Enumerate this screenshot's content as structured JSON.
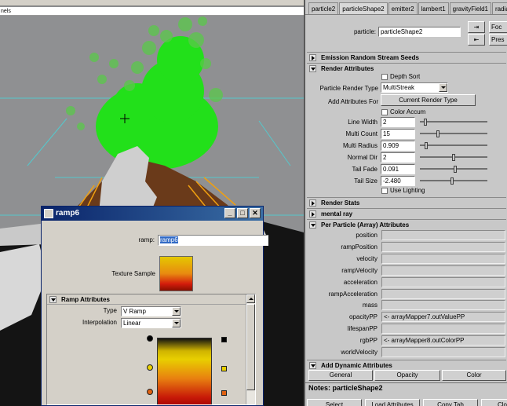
{
  "viewport": {
    "panels_label": "nels"
  },
  "ramp_window": {
    "title": "ramp6",
    "ramp_label": "ramp:",
    "ramp_value": "ramp6",
    "texture_sample_label": "Texture Sample",
    "section_title": "Ramp Attributes",
    "type_label": "Type",
    "type_value": "V Ramp",
    "interpolation_label": "Interpolation",
    "interpolation_value": "Linear",
    "colors": {
      "ramp_top": "#e8cf00",
      "ramp_mid": "#e88010",
      "ramp_bottom": "#c81a08"
    }
  },
  "attribute_editor": {
    "tabs": [
      "particle2",
      "particleShape2",
      "emitter2",
      "lambert1",
      "gravityField1",
      "radialField1"
    ],
    "active_tab": 1,
    "particle_label": "particle:",
    "particle_value": "particleShape2",
    "focus_button": "Foc",
    "presets_button": "Pres",
    "sections": {
      "emission": "Emission Random Stream Seeds",
      "render_attributes": "Render Attributes",
      "render_stats": "Render Stats",
      "mental_ray": "mental ray",
      "per_particle": "Per Particle (Array) Attributes",
      "add_dynamic": "Add Dynamic Attributes"
    },
    "render": {
      "depth_sort": "Depth Sort",
      "render_type_label": "Particle Render Type",
      "render_type_value": "MultiStreak",
      "add_attrs_label": "Add Attributes For",
      "current_render_type_button": "Current Render Type",
      "color_accum": "Color Accum",
      "use_lighting": "Use Lighting",
      "fields": [
        {
          "label": "Line Width",
          "value": "2",
          "slider": 0.06
        },
        {
          "label": "Multi Count",
          "value": "15",
          "slider": 0.25
        },
        {
          "label": "Multi Radius",
          "value": "0.909",
          "slider": 0.07
        },
        {
          "label": "Normal Dir",
          "value": "2",
          "slider": 0.5
        },
        {
          "label": "Tail Fade",
          "value": "0.091",
          "slider": 0.53
        },
        {
          "label": "Tail Size",
          "value": "-2.480",
          "slider": 0.48
        }
      ]
    },
    "per_particle_rows": [
      {
        "label": "position",
        "value": ""
      },
      {
        "label": "rampPosition",
        "value": ""
      },
      {
        "label": "velocity",
        "value": ""
      },
      {
        "label": "rampVelocity",
        "value": ""
      },
      {
        "label": "acceleration",
        "value": ""
      },
      {
        "label": "rampAcceleration",
        "value": ""
      },
      {
        "label": "mass",
        "value": ""
      },
      {
        "label": "opacityPP",
        "value": "<- arrayMapper7.outValuePP"
      },
      {
        "label": "lifespanPP",
        "value": ""
      },
      {
        "label": "rgbPP",
        "value": "<- arrayMapper8.outColorPP"
      },
      {
        "label": "worldVelocity",
        "value": ""
      }
    ],
    "dynamic_buttons": [
      "General",
      "Opacity",
      "Color"
    ],
    "notes_label": "Notes: particleShape2",
    "bottom_buttons": [
      "Select",
      "Load Attributes",
      "Copy Tab",
      "Clo"
    ]
  }
}
